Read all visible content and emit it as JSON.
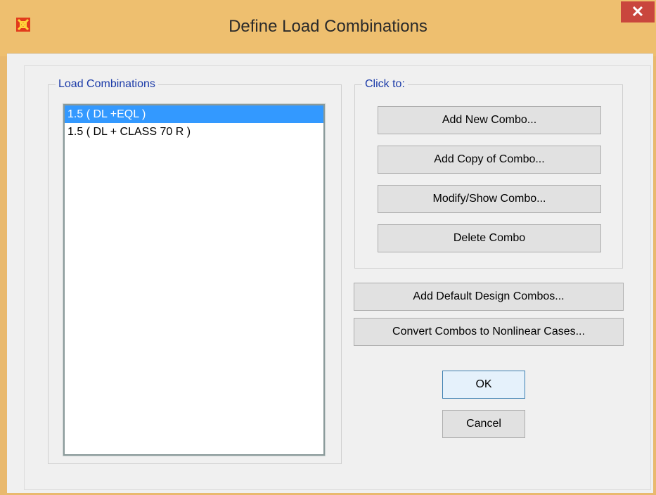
{
  "window": {
    "title": "Define Load Combinations",
    "close_label": "✕"
  },
  "load_combinations": {
    "group_label": "Load Combinations",
    "items": [
      {
        "label": "1.5 ( DL +EQL )",
        "selected": true
      },
      {
        "label": "1.5 ( DL + CLASS 70 R )",
        "selected": false
      }
    ]
  },
  "click_to": {
    "group_label": "Click to:",
    "add_new_combo": "Add New Combo...",
    "add_copy_of_combo": "Add Copy of Combo...",
    "modify_show_combo": "Modify/Show Combo...",
    "delete_combo": "Delete Combo"
  },
  "actions": {
    "add_default_design_combos": "Add Default Design Combos...",
    "convert_combos": "Convert Combos to Nonlinear Cases...",
    "ok": "OK",
    "cancel": "Cancel"
  },
  "colors": {
    "titlebar": "#eebf6f",
    "selection": "#3399ff",
    "group_label": "#1a3aa8",
    "close_button": "#c9463d"
  },
  "icons": {
    "app": "sap2000-app-icon",
    "close": "close-icon"
  }
}
